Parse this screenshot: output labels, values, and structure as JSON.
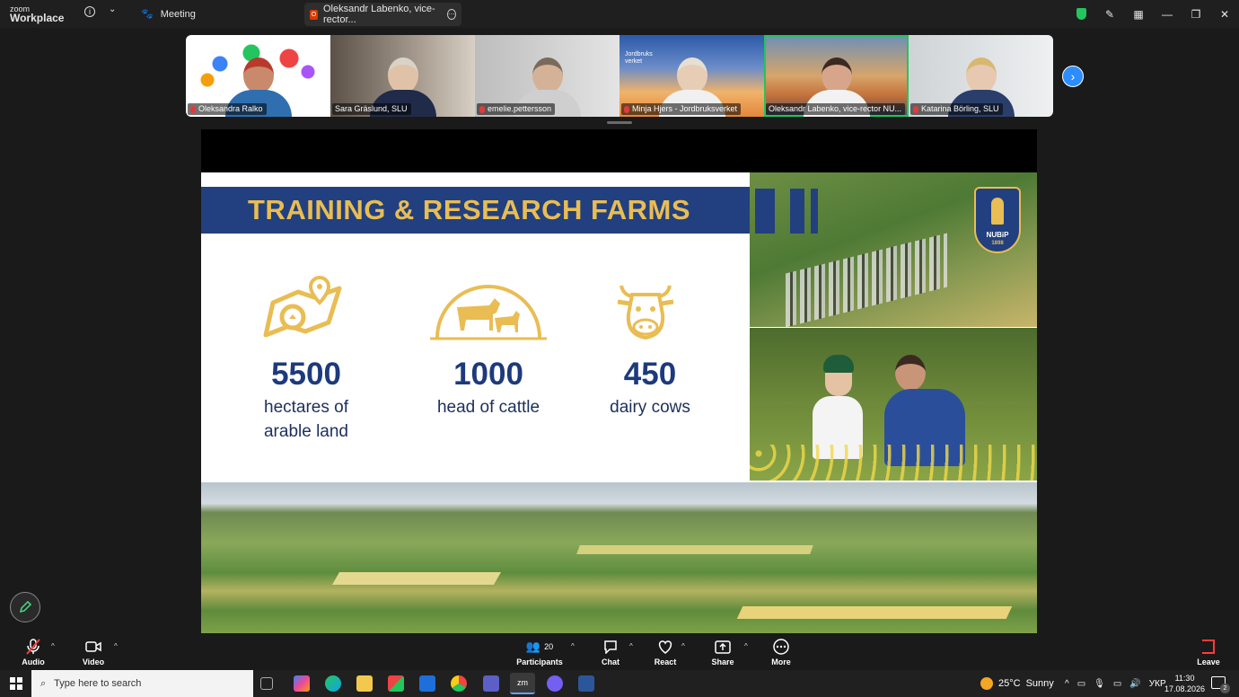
{
  "titlebar": {
    "logo_line1": "zoom",
    "logo_line2": "Workplace",
    "meeting_label": "Meeting",
    "tab_title": "Oleksandr Labenko, vice-rector...",
    "tab_badge": "O",
    "accent_shield": "#22c55e"
  },
  "gallery": {
    "participants": [
      {
        "name": "Oleksandra Ralko",
        "muted": true
      },
      {
        "name": "Sara Gräslund, SLU",
        "muted": false
      },
      {
        "name": "emelie.pettersson",
        "muted": true
      },
      {
        "name": "Minja Hjers - Jordbruksverket",
        "muted": true
      },
      {
        "name": "Oleksandr Labenko, vice-rector NU...",
        "muted": false,
        "active": true
      },
      {
        "name": "Katarina Börling, SLU",
        "muted": true
      }
    ],
    "jordbruks_logo": "Jordbruks verket"
  },
  "slide": {
    "title": "TRAINING & RESEARCH FARMS",
    "stats": [
      {
        "value": "5500",
        "label_line1": "hectares of",
        "label_line2": "arable land",
        "icon": "land-map-icon"
      },
      {
        "value": "1000",
        "label_line1": "head of cattle",
        "label_line2": "",
        "icon": "cattle-icon"
      },
      {
        "value": "450",
        "label_line1": "dairy cows",
        "label_line2": "",
        "icon": "cow-head-icon"
      }
    ],
    "emblem_text": "NUBiP",
    "emblem_year": "1898",
    "brand_blue": "#22407f",
    "brand_gold": "#e9bd53"
  },
  "toolbar": {
    "audio": "Audio",
    "video": "Video",
    "participants": "Participants",
    "participants_count": "20",
    "chat": "Chat",
    "react": "React",
    "share": "Share",
    "more": "More",
    "leave": "Leave"
  },
  "taskbar": {
    "search_placeholder": "Type here to search",
    "weather_temp": "25°C",
    "weather_text": "Sunny",
    "lang": "УКР",
    "time": "11:30",
    "date": "17.08.2026",
    "notifications": "2"
  }
}
